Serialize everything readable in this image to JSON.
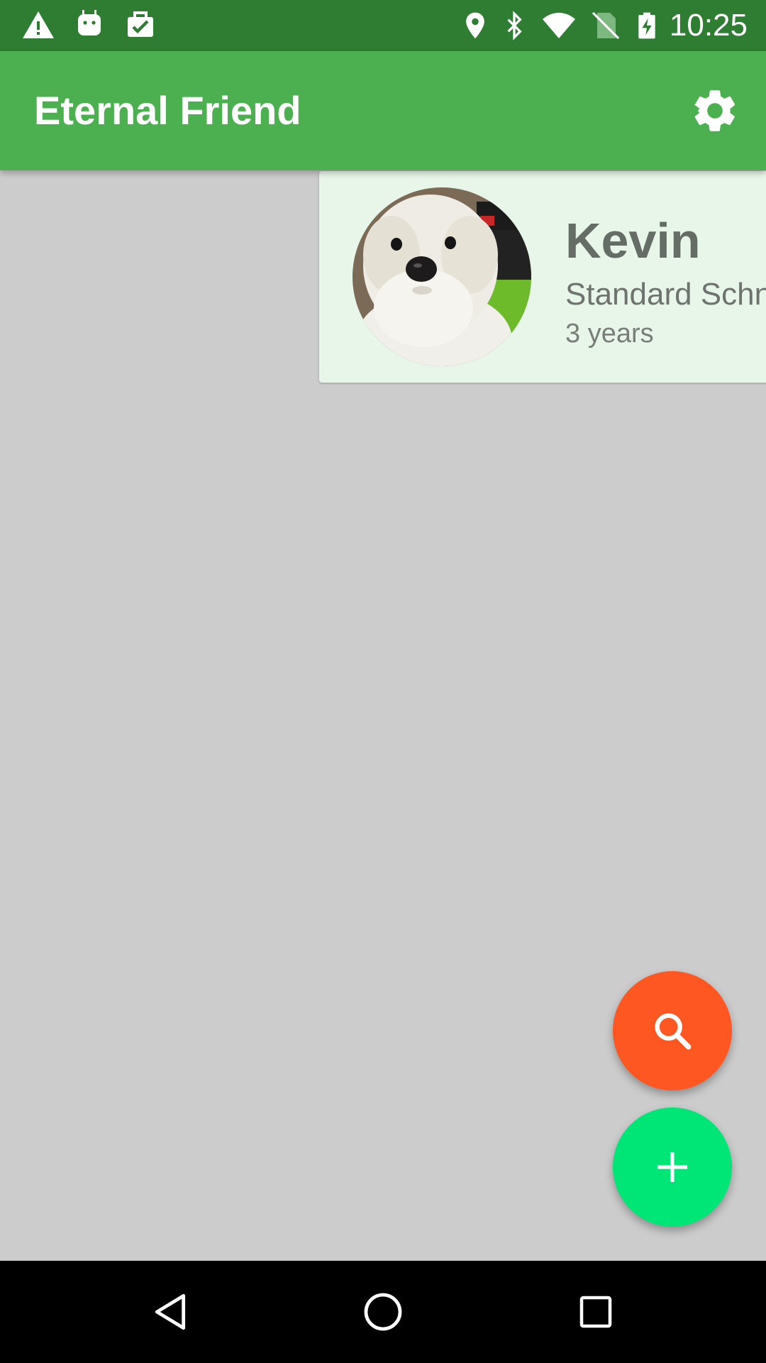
{
  "status_bar": {
    "time": "10:25",
    "left_icons": [
      "warning-icon",
      "android-icon",
      "clipboard-check-icon"
    ],
    "right_icons": [
      "location-icon",
      "bluetooth-icon",
      "wifi-icon",
      "no-sim-icon",
      "battery-charging-icon"
    ]
  },
  "app_bar": {
    "title": "Eternal Friend",
    "action_icon": "settings-gear-icon",
    "color": "#4caf50"
  },
  "pets": [
    {
      "name": "Kevin",
      "breed": "Standard Schn",
      "age": "3 years",
      "avatar_icon": "dog-photo"
    }
  ],
  "fabs": {
    "search": {
      "icon": "search-icon",
      "color": "#ff5722"
    },
    "add": {
      "icon": "plus-icon",
      "color": "#00e676"
    }
  },
  "nav_bar": {
    "buttons": [
      "back-icon",
      "home-icon",
      "recents-icon"
    ]
  },
  "colors": {
    "status_bar": "#2e7d32",
    "background": "#cccccc",
    "card": "#e8f5e9"
  }
}
